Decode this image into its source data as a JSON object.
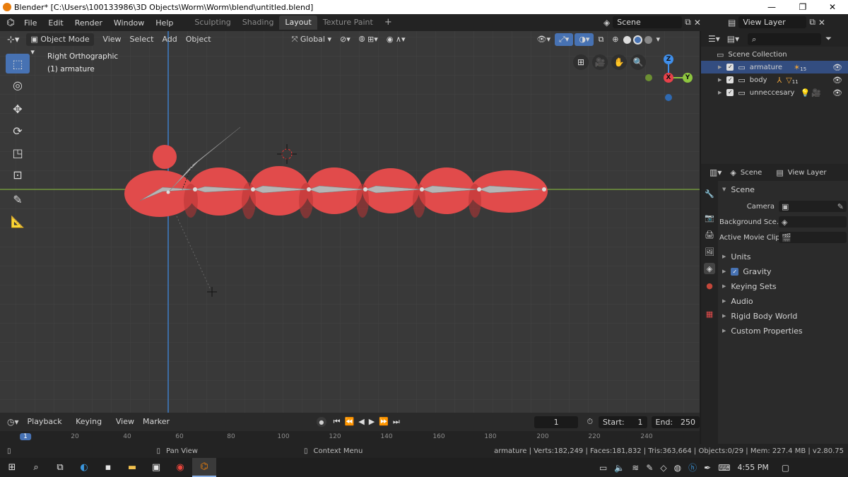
{
  "window": {
    "title": "Blender* [C:\\Users\\100133986\\3D Objects\\Worm\\Worm\\blend\\untitled.blend]",
    "controls": {
      "minimize": "—",
      "maximize": "❐",
      "close": "✕"
    }
  },
  "menubar": {
    "items": [
      "File",
      "Edit",
      "Render",
      "Window",
      "Help"
    ]
  },
  "workspaces": {
    "tabs": [
      "Sculpting",
      "Shading",
      "Layout",
      "Texture Paint"
    ],
    "active": "Layout",
    "add": "+"
  },
  "scene_selector": {
    "value": "Scene"
  },
  "view_layer_selector": {
    "value": "View Layer"
  },
  "viewport_header": {
    "mode": "Object Mode",
    "menus": [
      "View",
      "Select",
      "Add",
      "Object"
    ],
    "orientation": "Global"
  },
  "viewport": {
    "view_name": "Right Orthographic",
    "object_info": "(1) armature"
  },
  "axis_gizmo": {
    "z": "Z",
    "x": "X",
    "y": "Y"
  },
  "outliner": {
    "root": "Scene Collection",
    "items": [
      {
        "name": "armature",
        "badge": "15",
        "selected": true
      },
      {
        "name": "body",
        "badge": "11",
        "selected": false
      },
      {
        "name": "unneccesary",
        "badge": "",
        "selected": false
      }
    ],
    "search_placeholder": ""
  },
  "properties": {
    "header_scene": "Scene",
    "header_view_layer": "View Layer",
    "panel_title": "Scene",
    "fields": [
      {
        "label": "Camera",
        "value": ""
      },
      {
        "label": "Background Sce..",
        "value": ""
      },
      {
        "label": "Active Movie Clip",
        "value": ""
      }
    ],
    "sections": [
      {
        "label": "Units",
        "checkbox": false
      },
      {
        "label": "Gravity",
        "checkbox": true
      },
      {
        "label": "Keying Sets",
        "checkbox": false
      },
      {
        "label": "Audio",
        "checkbox": false
      },
      {
        "label": "Rigid Body World",
        "checkbox": false
      },
      {
        "label": "Custom Properties",
        "checkbox": false
      }
    ]
  },
  "timeline": {
    "menus": [
      "Playback",
      "Keying",
      "View",
      "Marker"
    ],
    "current_frame": "1",
    "start_label": "Start:",
    "start": "1",
    "end_label": "End:",
    "end": "250",
    "ruler_ticks": [
      "1",
      "20",
      "40",
      "60",
      "80",
      "100",
      "120",
      "140",
      "160",
      "180",
      "200",
      "220",
      "240"
    ]
  },
  "statusbar": {
    "pan": "Pan View",
    "context": "Context Menu",
    "stats": "armature | Verts:182,249 | Faces:181,832 | Tris:363,664 | Objects:0/29 | Mem: 227.4 MB | v2.80.75"
  },
  "taskbar": {
    "time": "4:55 PM"
  },
  "colors": {
    "accent": "#4772b3",
    "mesh": "#e14b4b",
    "bone": "#b5b5b5",
    "axis_x": "#e8414a",
    "axis_y": "#8ec63f",
    "axis_z": "#3f8eea"
  }
}
